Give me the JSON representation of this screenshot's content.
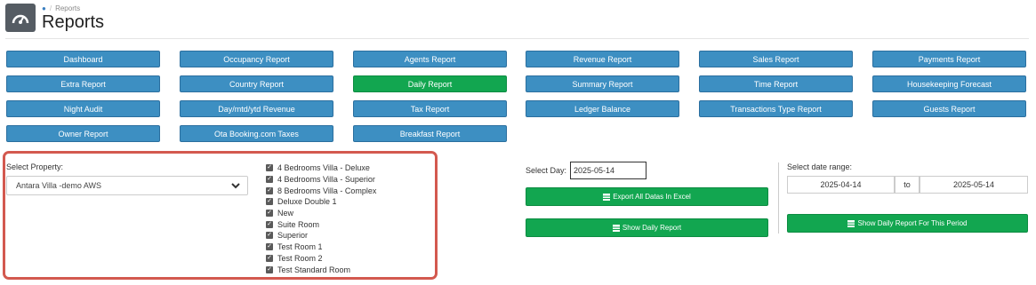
{
  "header": {
    "breadcrumb": "Reports",
    "title": "Reports"
  },
  "report_buttons": [
    {
      "label": "Dashboard",
      "active": false
    },
    {
      "label": "Occupancy Report",
      "active": false
    },
    {
      "label": "Agents Report",
      "active": false
    },
    {
      "label": "Revenue Report",
      "active": false
    },
    {
      "label": "Sales Report",
      "active": false
    },
    {
      "label": "Payments Report",
      "active": false
    },
    {
      "label": "Extra Report",
      "active": false
    },
    {
      "label": "Country Report",
      "active": false
    },
    {
      "label": "Daily Report",
      "active": true
    },
    {
      "label": "Summary Report",
      "active": false
    },
    {
      "label": "Time Report",
      "active": false
    },
    {
      "label": "Housekeeping Forecast",
      "active": false
    },
    {
      "label": "Night Audit",
      "active": false
    },
    {
      "label": "Day/mtd/ytd Revenue",
      "active": false
    },
    {
      "label": "Tax Report",
      "active": false
    },
    {
      "label": "Ledger Balance",
      "active": false
    },
    {
      "label": "Transactions Type Report",
      "active": false
    },
    {
      "label": "Guests Report",
      "active": false
    },
    {
      "label": "Owner Report",
      "active": false
    },
    {
      "label": "Ota Booking.com Taxes",
      "active": false
    },
    {
      "label": "Breakfast Report",
      "active": false
    }
  ],
  "property": {
    "label": "Select Property:",
    "selected": "Antara Villa -demo AWS"
  },
  "rooms": [
    "4 Bedrooms Villa - Deluxe",
    "4 Bedrooms Villa - Superior",
    "8 Bedrooms Villa - Complex",
    "Deluxe Double 1",
    "New",
    "Suite Room",
    "Superior",
    "Test Room 1",
    "Test Room 2",
    "Test Standard Room"
  ],
  "day": {
    "label": "Select Day:",
    "value": "2025-05-14",
    "export_label": "Export All Datas In Excel",
    "show_label": "Show Daily Report"
  },
  "range": {
    "label": "Select date range:",
    "from": "2025-04-14",
    "to_label": "to",
    "to": "2025-05-14",
    "show_label": "Show Daily Report For This Period"
  },
  "colors": {
    "blue_button": "#3d8fc2",
    "green_button": "#12a650",
    "highlight_border": "#d3594f"
  }
}
